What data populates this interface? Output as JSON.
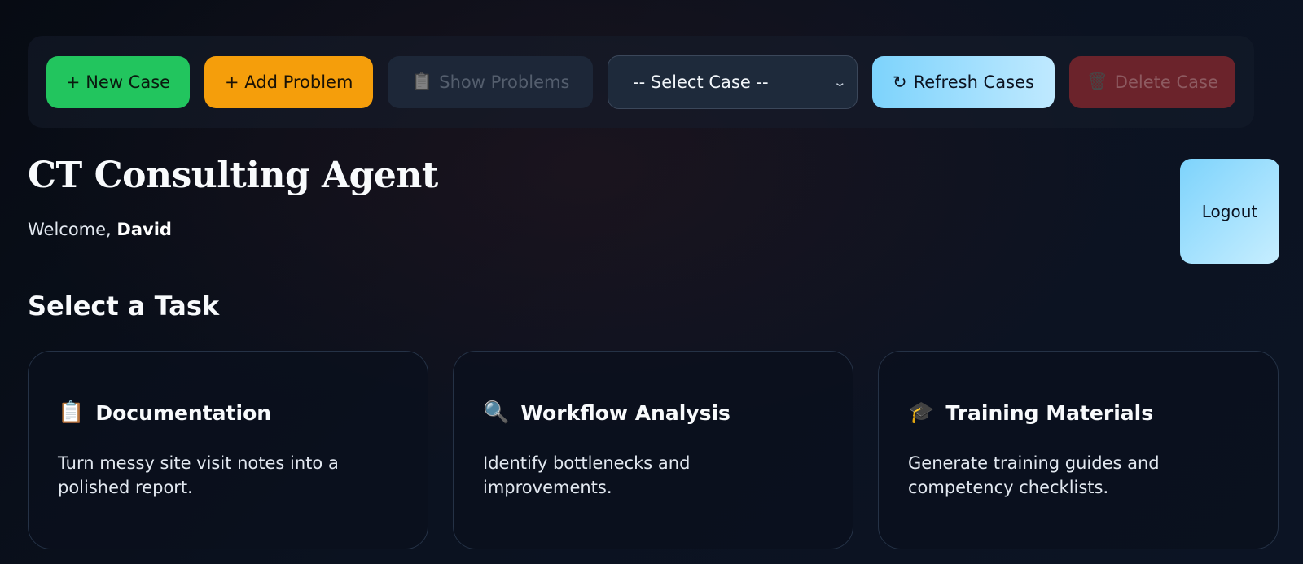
{
  "toolbar": {
    "new_case": "+ New Case",
    "add_problem": "+ Add Problem",
    "show_problems": "Show Problems",
    "select_case": "-- Select Case --",
    "refresh_cases": "Refresh Cases",
    "delete_case": "Delete Case",
    "icons": {
      "show_problems": "clipboard-icon",
      "refresh": "refresh-icon",
      "delete": "trash-icon"
    }
  },
  "header": {
    "title": "CT Consulting Agent",
    "welcome_prefix": "Welcome, ",
    "user_name": "David",
    "logout": "Logout"
  },
  "tasks": {
    "section_title": "Select a Task",
    "items": [
      {
        "icon": "clipboard-icon",
        "title": "Documentation",
        "description": "Turn messy site visit notes into a polished report."
      },
      {
        "icon": "magnifier-icon",
        "title": "Workflow Analysis",
        "description": "Identify bottlenecks and improvements."
      },
      {
        "icon": "graduation-cap-icon",
        "title": "Training Materials",
        "description": "Generate training guides and competency checklists."
      }
    ]
  },
  "colors": {
    "new_case": "#22c55e",
    "add_problem": "#f59e0b",
    "refresh": "#7dd3fc",
    "delete": "#6b232b"
  }
}
